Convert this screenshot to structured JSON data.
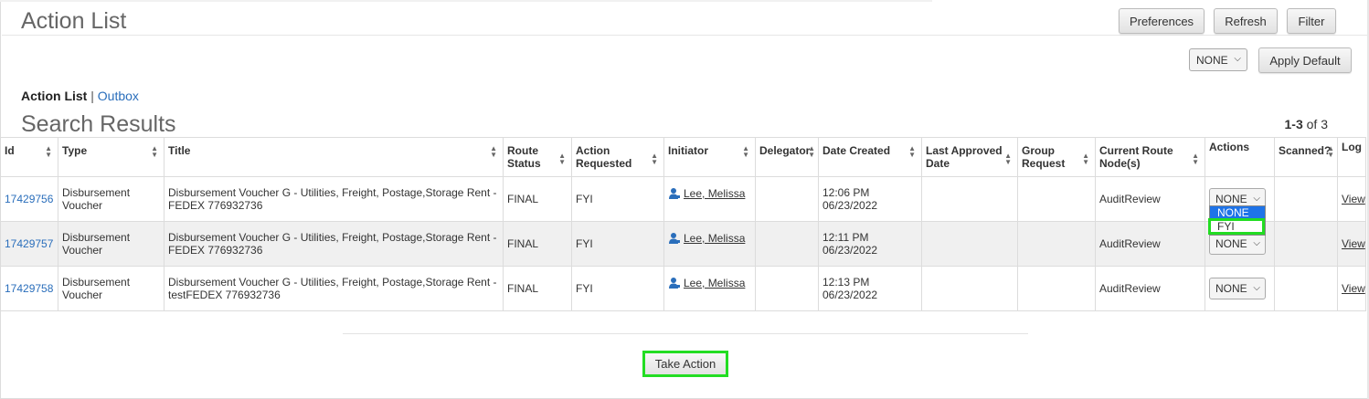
{
  "header": {
    "title": "Action List",
    "buttons": {
      "preferences": "Preferences",
      "refresh": "Refresh",
      "filter": "Filter"
    }
  },
  "default_action": {
    "value": "NONE",
    "apply_label": "Apply Default"
  },
  "tabs": {
    "active": "Action List",
    "separator": "|",
    "outbox": "Outbox"
  },
  "results": {
    "title": "Search Results",
    "range_bold": "1-3",
    "range_rest": " of 3"
  },
  "table": {
    "columns": [
      "Id",
      "Type",
      "Title",
      "Route Status",
      "Action Requested",
      "Initiator",
      "Delegator",
      "Date Created",
      "Last Approved Date",
      "Group Request",
      "Current Route Node(s)",
      "Actions",
      "Scanned?",
      "Log"
    ],
    "rows": [
      {
        "id": "17429756",
        "type": "Disbursement Voucher",
        "title": "Disbursement Voucher G - Utilities, Freight, Postage,Storage Rent - FEDEX 776932736",
        "route_status": "FINAL",
        "action_requested": "FYI",
        "initiator": "Lee, Melissa",
        "delegator": "",
        "date_time": "12:06 PM",
        "date_day": "06/23/2022",
        "last_approved": "",
        "group_request": "",
        "route_node": "AuditReview",
        "action": "NONE",
        "scanned": "",
        "log": "View"
      },
      {
        "id": "17429757",
        "type": "Disbursement Voucher",
        "title": "Disbursement Voucher G - Utilities, Freight, Postage,Storage Rent - FEDEX 776932736",
        "route_status": "FINAL",
        "action_requested": "FYI",
        "initiator": "Lee, Melissa",
        "delegator": "",
        "date_time": "12:11 PM",
        "date_day": "06/23/2022",
        "last_approved": "",
        "group_request": "",
        "route_node": "AuditReview",
        "action": "NONE",
        "scanned": "",
        "log": "View"
      },
      {
        "id": "17429758",
        "type": "Disbursement Voucher",
        "title": "Disbursement Voucher G - Utilities, Freight, Postage,Storage Rent - testFEDEX 776932736",
        "route_status": "FINAL",
        "action_requested": "FYI",
        "initiator": "Lee, Melissa",
        "delegator": "",
        "date_time": "12:13 PM",
        "date_day": "06/23/2022",
        "last_approved": "",
        "group_request": "",
        "route_node": "AuditReview",
        "action": "NONE",
        "scanned": "",
        "log": "View"
      }
    ]
  },
  "open_dropdown": {
    "options": [
      "NONE",
      "FYI"
    ],
    "highlighted": "NONE"
  },
  "footer": {
    "take_action": "Take Action"
  },
  "colors": {
    "link": "#2a6ebb",
    "highlight_box": "#22dd22",
    "option_highlight": "#1e73e8",
    "alt_row": "#f0f0f0"
  },
  "icons": {
    "sort": "sort-arrows-icon",
    "initiator": "person-icon",
    "select": "chevron-down-icon"
  }
}
